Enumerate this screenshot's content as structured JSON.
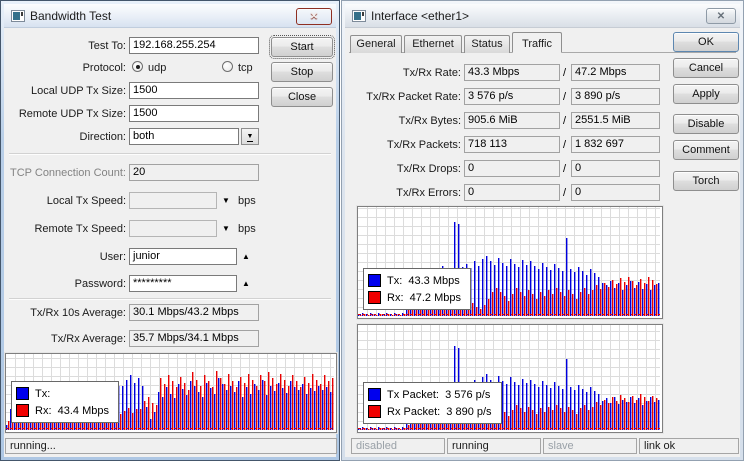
{
  "left_window": {
    "title": "Bandwidth Test",
    "rows": {
      "test_to": {
        "label": "Test To:",
        "value": "192.168.255.254"
      },
      "protocol": {
        "label": "Protocol:",
        "options": [
          {
            "label": "udp",
            "selected": true
          },
          {
            "label": "tcp",
            "selected": false
          }
        ]
      },
      "local_udp": {
        "label": "Local UDP Tx Size:",
        "value": "1500"
      },
      "remote_udp": {
        "label": "Remote UDP Tx Size:",
        "value": "1500"
      },
      "direction": {
        "label": "Direction:",
        "value": "both"
      },
      "tcp_count": {
        "label": "TCP Connection Count:",
        "value": "20"
      },
      "local_tx": {
        "label": "Local Tx Speed:",
        "value": "",
        "unit": "bps"
      },
      "remote_tx": {
        "label": "Remote Tx Speed:",
        "value": "",
        "unit": "bps"
      },
      "user": {
        "label": "User:",
        "value": "junior"
      },
      "password": {
        "label": "Password:",
        "value": "*********"
      },
      "avg10": {
        "label": "Tx/Rx 10s Average:",
        "value": "30.1 Mbps/43.2 Mbps"
      },
      "avg": {
        "label": "Tx/Rx Average:",
        "value": "35.7 Mbps/34.1 Mbps"
      }
    },
    "buttons": {
      "start": "Start",
      "stop": "Stop",
      "close": "Close"
    },
    "legend": {
      "tx": "Tx:",
      "rx": "Rx:  43.4 Mbps"
    },
    "status": "running..."
  },
  "right_window": {
    "title": "Interface <ether1>",
    "tabs": [
      "General",
      "Ethernet",
      "Status",
      "Traffic"
    ],
    "active_tab": "Traffic",
    "separator": "/",
    "rows": [
      {
        "label": "Tx/Rx Rate:",
        "tx": "43.3 Mbps",
        "rx": "47.2 Mbps"
      },
      {
        "label": "Tx/Rx Packet Rate:",
        "tx": "3 576 p/s",
        "rx": "3 890 p/s"
      },
      {
        "label": "Tx/Rx Bytes:",
        "tx": "905.6 MiB",
        "rx": "2551.5 MiB"
      },
      {
        "label": "Tx/Rx Packets:",
        "tx": "718 113",
        "rx": "1 832 697"
      },
      {
        "label": "Tx/Rx Drops:",
        "tx": "0",
        "rx": "0"
      },
      {
        "label": "Tx/Rx Errors:",
        "tx": "0",
        "rx": "0"
      }
    ],
    "buttons": {
      "ok": "OK",
      "cancel": "Cancel",
      "apply": "Apply",
      "disable": "Disable",
      "comment": "Comment",
      "torch": "Torch"
    },
    "legend_rate": {
      "tx": "Tx:  43.3 Mbps",
      "rx": "Rx:  47.2 Mbps"
    },
    "legend_packet": {
      "tx": "Tx Packet:  3 576 p/s",
      "rx": "Rx Packet:  3 890 p/s"
    },
    "status": [
      {
        "text": "disabled",
        "muted": true
      },
      {
        "text": "running",
        "muted": false
      },
      {
        "text": "slave",
        "muted": true
      },
      {
        "text": "link ok",
        "muted": false
      }
    ]
  },
  "icons": {
    "close": "✕"
  },
  "chart_data": [
    {
      "id": "bandwidth-test-traffic",
      "type": "bar",
      "title": "Tx/Rx bandwidth history",
      "ylim": [
        0,
        100
      ],
      "grid": true,
      "legend_position": "bottom-left",
      "current": {
        "tx": "",
        "rx": "43.4 Mbps"
      },
      "series": [
        {
          "name": "Tx",
          "color": "#0000dd",
          "values": [
            6,
            28,
            20,
            32,
            18,
            25,
            35,
            22,
            30,
            26,
            38,
            24,
            31,
            27,
            42,
            36,
            29,
            33,
            26,
            38,
            30,
            24,
            28,
            34,
            30,
            26,
            45,
            40,
            58,
            58,
            66,
            72,
            62,
            68,
            58,
            30,
            14,
            24,
            50,
            44,
            56,
            48,
            42,
            60,
            54,
            46,
            64,
            58,
            50,
            44,
            62,
            55,
            48,
            68,
            60,
            52,
            58,
            50,
            64,
            44,
            56,
            48,
            60,
            53,
            66,
            46,
            58,
            51,
            62,
            55,
            49,
            64,
            57,
            52,
            60,
            47,
            55,
            51,
            58,
            53,
            57,
            50
          ]
        },
        {
          "name": "Rx",
          "color": "#e80000",
          "values": [
            12,
            46,
            36,
            42,
            30,
            38,
            44,
            33,
            45,
            36,
            48,
            34,
            42,
            37,
            50,
            41,
            36,
            43,
            38,
            34,
            30,
            27,
            24,
            21,
            25,
            23,
            19,
            17,
            21,
            25,
            29,
            23,
            27,
            27,
            38,
            44,
            36,
            33,
            68,
            60,
            73,
            64,
            56,
            70,
            62,
            53,
            76,
            66,
            58,
            72,
            64,
            56,
            78,
            68,
            60,
            74,
            64,
            56,
            70,
            62,
            74,
            66,
            58,
            72,
            64,
            76,
            68,
            60,
            74,
            66,
            58,
            72,
            64,
            56,
            70,
            62,
            74,
            66,
            60,
            72,
            64,
            68
          ]
        }
      ]
    },
    {
      "id": "ether1-rate-graph",
      "type": "bar",
      "title": "Tx/Rx rate history",
      "ylim": [
        0,
        100
      ],
      "grid": true,
      "legend_position": "bottom-left",
      "current": {
        "tx": "43.3 Mbps",
        "rx": "47.2 Mbps"
      },
      "series": [
        {
          "name": "Tx",
          "color": "#0000dd",
          "values": [
            2,
            3,
            2,
            3,
            2,
            3,
            2,
            3,
            2,
            3,
            2,
            3,
            30,
            36,
            40,
            38,
            42,
            37,
            44,
            40,
            38,
            46,
            42,
            39,
            86,
            84,
            45,
            48,
            44,
            50,
            46,
            52,
            55,
            50,
            47,
            53,
            49,
            46,
            52,
            48,
            45,
            51,
            47,
            50,
            46,
            43,
            49,
            45,
            42,
            48,
            44,
            41,
            72,
            43,
            40,
            45,
            41,
            38,
            43,
            39,
            36,
            30,
            28,
            32,
            26,
            30,
            24,
            28,
            32,
            26,
            31,
            25,
            29,
            24,
            28,
            30
          ]
        },
        {
          "name": "Rx",
          "color": "#e80000",
          "values": [
            1,
            2,
            1,
            2,
            1,
            2,
            1,
            2,
            1,
            2,
            1,
            2,
            6,
            10,
            25,
            28,
            22,
            18,
            14,
            10,
            8,
            6,
            8,
            12,
            18,
            24,
            20,
            16,
            12,
            8,
            6,
            10,
            16,
            22,
            26,
            22,
            18,
            14,
            20,
            26,
            22,
            18,
            24,
            20,
            16,
            22,
            18,
            24,
            20,
            26,
            22,
            18,
            24,
            20,
            16,
            22,
            26,
            20,
            24,
            28,
            25,
            30,
            27,
            33,
            29,
            35,
            31,
            36,
            32,
            28,
            34,
            30,
            36,
            33,
            29,
            34
          ]
        }
      ]
    },
    {
      "id": "ether1-packet-graph",
      "type": "bar",
      "title": "Tx/Rx packet rate history",
      "ylim": [
        0,
        100
      ],
      "grid": true,
      "legend_position": "bottom-left",
      "current": {
        "tx": "3 576 p/s",
        "rx": "3 890 p/s"
      },
      "series": [
        {
          "name": "Tx Packet",
          "color": "#0000dd",
          "values": [
            2,
            3,
            2,
            3,
            2,
            3,
            2,
            3,
            2,
            3,
            2,
            3,
            28,
            34,
            38,
            40,
            44,
            39,
            42,
            38,
            40,
            44,
            40,
            37,
            80,
            78,
            43,
            46,
            42,
            48,
            44,
            50,
            53,
            48,
            45,
            51,
            47,
            44,
            50,
            46,
            43,
            49,
            45,
            48,
            44,
            41,
            47,
            43,
            40,
            46,
            42,
            39,
            68,
            41,
            38,
            43,
            39,
            36,
            41,
            37,
            34,
            28,
            30,
            26,
            31,
            25,
            29,
            27,
            31,
            26,
            30,
            24,
            28,
            31,
            27,
            29
          ]
        },
        {
          "name": "Rx Packet",
          "color": "#e80000",
          "values": [
            1,
            2,
            1,
            2,
            1,
            2,
            1,
            2,
            1,
            2,
            1,
            2,
            5,
            9,
            23,
            26,
            20,
            16,
            12,
            9,
            7,
            6,
            8,
            11,
            17,
            22,
            19,
            15,
            11,
            8,
            6,
            9,
            15,
            21,
            24,
            21,
            17,
            13,
            19,
            24,
            21,
            17,
            22,
            19,
            15,
            21,
            17,
            22,
            19,
            24,
            21,
            17,
            22,
            19,
            15,
            21,
            24,
            19,
            22,
            27,
            24,
            29,
            26,
            31,
            28,
            33,
            30,
            27,
            32,
            29,
            34,
            31,
            28,
            32,
            30,
            33
          ]
        }
      ]
    }
  ]
}
